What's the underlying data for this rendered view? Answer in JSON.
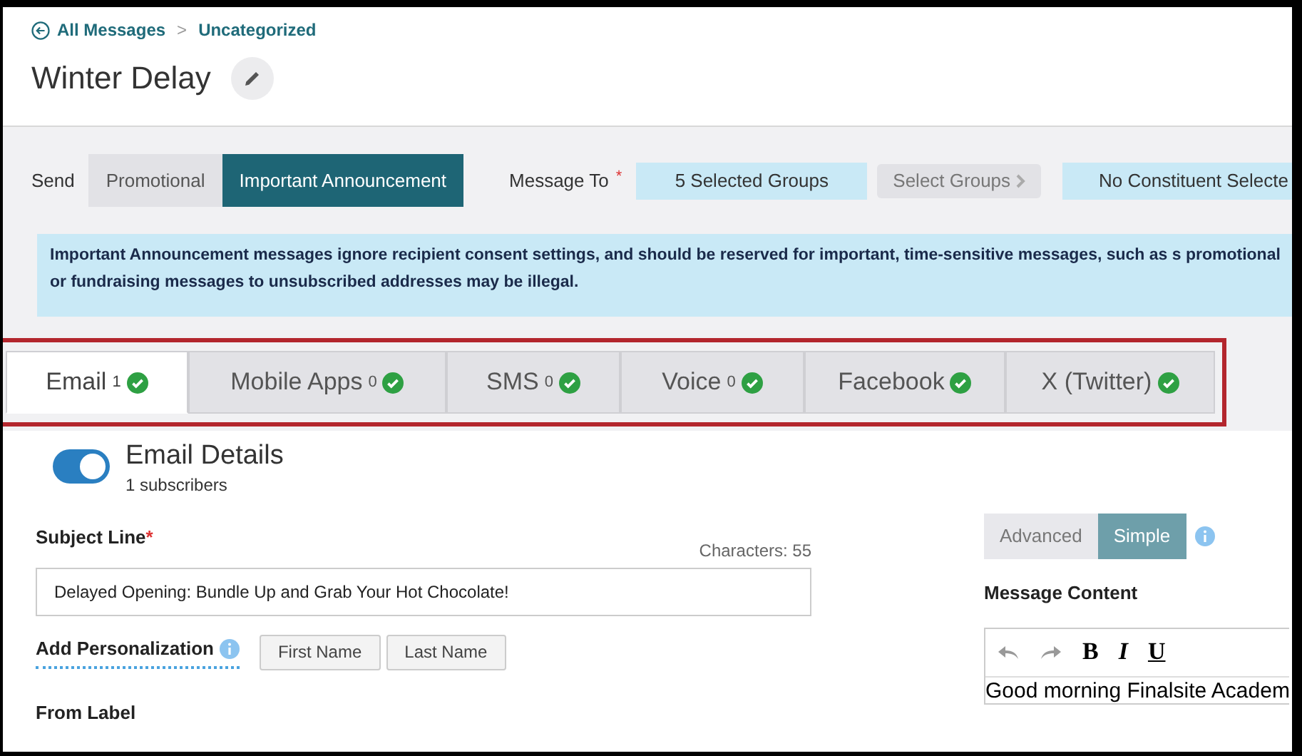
{
  "breadcrumb": {
    "back": "All Messages",
    "separator": ">",
    "current": "Uncategorized"
  },
  "title": "Winter Delay",
  "send": {
    "label": "Send",
    "options": [
      {
        "label": "Promotional",
        "selected": false
      },
      {
        "label": "Important Announcement",
        "selected": true
      }
    ]
  },
  "message_to": {
    "label": "Message To",
    "required_mark": "*",
    "groups": "5 Selected Groups",
    "select_groups": "Select Groups",
    "constituents": "No Constituent Selecte"
  },
  "notice": "Important Announcement messages ignore recipient consent settings, and should be reserved for important, time-sensitive messages, such as s promotional or fundraising messages to unsubscribed addresses may be illegal.",
  "tabs": [
    {
      "label": "Email",
      "count": "1",
      "selected": true
    },
    {
      "label": "Mobile Apps",
      "count": "0",
      "selected": false
    },
    {
      "label": "SMS",
      "count": "0",
      "selected": false
    },
    {
      "label": "Voice",
      "count": "0",
      "selected": false
    },
    {
      "label": "Facebook",
      "selected": false
    },
    {
      "label": "X (Twitter)",
      "selected": false
    }
  ],
  "email_details": {
    "on": true,
    "title": "Email Details",
    "subscribers": "1 subscribers"
  },
  "subject": {
    "label": "Subject Line",
    "required_mark": "*",
    "counter": "Characters: 55",
    "value": "Delayed Opening: Bundle Up and Grab Your Hot Chocolate!"
  },
  "personalization": {
    "label": "Add Personalization",
    "buttons": [
      "First Name",
      "Last Name"
    ]
  },
  "from_label": "From Label",
  "editor_mode": [
    {
      "label": "Advanced",
      "selected": false
    },
    {
      "label": "Simple",
      "selected": true
    }
  ],
  "message_content": {
    "label": "Message Content",
    "toolbar": [
      "B",
      "I",
      "U"
    ],
    "text": "Good morning Finalsite Academ"
  }
}
